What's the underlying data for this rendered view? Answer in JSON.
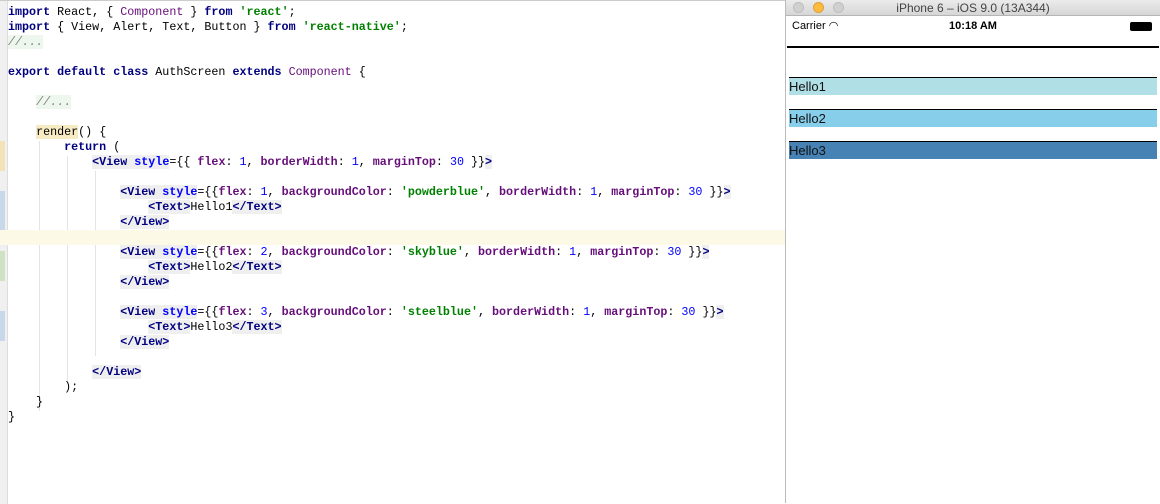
{
  "editor": {
    "current_line": 15,
    "lines": [
      [
        [
          "kw",
          "import"
        ],
        [
          "txt",
          " React, { "
        ],
        [
          "cls",
          "Component"
        ],
        [
          "txt",
          " } "
        ],
        [
          "kw",
          "from"
        ],
        [
          "txt",
          " "
        ],
        [
          "str",
          "'react'"
        ],
        [
          "txt",
          ";"
        ]
      ],
      [
        [
          "kw",
          "import"
        ],
        [
          "txt",
          " { View, Alert, Text, Button } "
        ],
        [
          "kw",
          "from"
        ],
        [
          "txt",
          " "
        ],
        [
          "str",
          "'react-native'"
        ],
        [
          "txt",
          ";"
        ]
      ],
      [
        [
          "cm",
          "//..."
        ]
      ],
      [],
      [
        [
          "kw",
          "export default class"
        ],
        [
          "txt",
          " AuthScreen "
        ],
        [
          "kw",
          "extends"
        ],
        [
          "txt",
          " "
        ],
        [
          "cls",
          "Component"
        ],
        [
          "txt",
          " {"
        ]
      ],
      [],
      [
        [
          "txt",
          "    "
        ],
        [
          "cm",
          "//..."
        ]
      ],
      [],
      [
        [
          "txt",
          "    "
        ],
        [
          "fn",
          "render"
        ],
        [
          "txt",
          "() {"
        ]
      ],
      [
        [
          "txt",
          "        "
        ],
        [
          "kw",
          "return"
        ],
        [
          "txt",
          " ("
        ]
      ],
      [
        [
          "txt",
          "            "
        ],
        [
          "tag",
          "<View"
        ],
        [
          "attr",
          " style"
        ],
        [
          "txt",
          "={{ "
        ],
        [
          "prop",
          "flex"
        ],
        [
          "txt",
          ": "
        ],
        [
          "num",
          "1"
        ],
        [
          "txt",
          ", "
        ],
        [
          "prop",
          "borderWidth"
        ],
        [
          "txt",
          ": "
        ],
        [
          "num",
          "1"
        ],
        [
          "txt",
          ", "
        ],
        [
          "prop",
          "marginTop"
        ],
        [
          "txt",
          ": "
        ],
        [
          "num",
          "30"
        ],
        [
          "txt",
          " }}"
        ],
        [
          "tag",
          ">"
        ]
      ],
      [],
      [
        [
          "txt",
          "                "
        ],
        [
          "tag",
          "<View"
        ],
        [
          "attr",
          " style"
        ],
        [
          "txt",
          "={{"
        ],
        [
          "prop",
          "flex"
        ],
        [
          "txt",
          ": "
        ],
        [
          "num",
          "1"
        ],
        [
          "txt",
          ", "
        ],
        [
          "prop",
          "backgroundColor"
        ],
        [
          "txt",
          ": "
        ],
        [
          "str",
          "'powderblue'"
        ],
        [
          "txt",
          ", "
        ],
        [
          "prop",
          "borderWidth"
        ],
        [
          "txt",
          ": "
        ],
        [
          "num",
          "1"
        ],
        [
          "txt",
          ", "
        ],
        [
          "prop",
          "marginTop"
        ],
        [
          "txt",
          ": "
        ],
        [
          "num",
          "30"
        ],
        [
          "txt",
          " }}"
        ],
        [
          "tag",
          ">"
        ]
      ],
      [
        [
          "txt",
          "                    "
        ],
        [
          "tag",
          "<Text>"
        ],
        [
          "txt",
          "Hello1"
        ],
        [
          "tag",
          "</Text>"
        ]
      ],
      [
        [
          "txt",
          "                "
        ],
        [
          "tag",
          "</View>"
        ]
      ],
      [],
      [
        [
          "txt",
          "                "
        ],
        [
          "tag",
          "<View"
        ],
        [
          "attr",
          " style"
        ],
        [
          "txt",
          "={{"
        ],
        [
          "prop",
          "flex"
        ],
        [
          "txt",
          ": "
        ],
        [
          "num",
          "2"
        ],
        [
          "txt",
          ", "
        ],
        [
          "prop",
          "backgroundColor"
        ],
        [
          "txt",
          ": "
        ],
        [
          "str",
          "'skyblue'"
        ],
        [
          "txt",
          ", "
        ],
        [
          "prop",
          "borderWidth"
        ],
        [
          "txt",
          ": "
        ],
        [
          "num",
          "1"
        ],
        [
          "txt",
          ", "
        ],
        [
          "prop",
          "marginTop"
        ],
        [
          "txt",
          ": "
        ],
        [
          "num",
          "30"
        ],
        [
          "txt",
          " }}"
        ],
        [
          "tag",
          ">"
        ]
      ],
      [
        [
          "txt",
          "                    "
        ],
        [
          "tag",
          "<Text>"
        ],
        [
          "txt",
          "Hello2"
        ],
        [
          "tag",
          "</Text>"
        ]
      ],
      [
        [
          "txt",
          "                "
        ],
        [
          "tag",
          "</View>"
        ]
      ],
      [],
      [
        [
          "txt",
          "                "
        ],
        [
          "tag",
          "<View"
        ],
        [
          "attr",
          " style"
        ],
        [
          "txt",
          "={{"
        ],
        [
          "prop",
          "flex"
        ],
        [
          "txt",
          ": "
        ],
        [
          "num",
          "3"
        ],
        [
          "txt",
          ", "
        ],
        [
          "prop",
          "backgroundColor"
        ],
        [
          "txt",
          ": "
        ],
        [
          "str",
          "'steelblue'"
        ],
        [
          "txt",
          ", "
        ],
        [
          "prop",
          "borderWidth"
        ],
        [
          "txt",
          ": "
        ],
        [
          "num",
          "1"
        ],
        [
          "txt",
          ", "
        ],
        [
          "prop",
          "marginTop"
        ],
        [
          "txt",
          ": "
        ],
        [
          "num",
          "30"
        ],
        [
          "txt",
          " }}"
        ],
        [
          "tag",
          ">"
        ]
      ],
      [
        [
          "txt",
          "                    "
        ],
        [
          "tag",
          "<Text>"
        ],
        [
          "txt",
          "Hello3"
        ],
        [
          "tag",
          "</Text>"
        ]
      ],
      [
        [
          "txt",
          "                "
        ],
        [
          "tag",
          "</View>"
        ]
      ],
      [],
      [
        [
          "txt",
          "            "
        ],
        [
          "tag",
          "</View>"
        ]
      ],
      [
        [
          "txt",
          "        );"
        ]
      ],
      [
        [
          "txt",
          "    }"
        ]
      ],
      [
        [
          "txt",
          "}"
        ]
      ]
    ]
  },
  "simulator": {
    "title": "iPhone 6 – iOS 9.0 (13A344)",
    "carrier": "Carrier",
    "time": "10:18 AM",
    "boxes": [
      {
        "label": "Hello1",
        "color": "#b0e0e6"
      },
      {
        "label": "Hello2",
        "color": "#87ceeb"
      },
      {
        "label": "Hello3",
        "color": "#4682b4"
      }
    ]
  }
}
